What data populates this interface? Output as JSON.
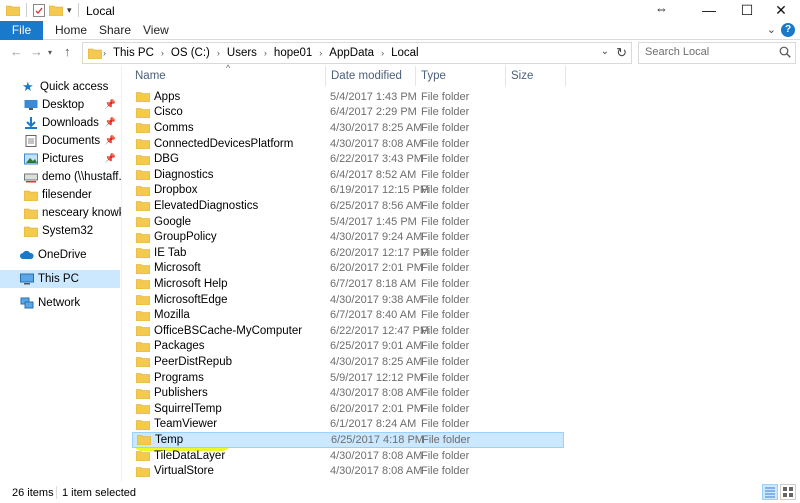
{
  "window": {
    "title": "Local",
    "minimize_glyph": "—",
    "maximize_glyph": "☐",
    "close_glyph": "✕"
  },
  "ribbon": {
    "tabs": [
      "File",
      "Home",
      "Share",
      "View"
    ]
  },
  "address": {
    "breadcrumbs": [
      "This PC",
      "OS (C:)",
      "Users",
      "hope01",
      "AppData",
      "Local"
    ]
  },
  "search": {
    "placeholder": "Search Local"
  },
  "nav_pane": {
    "items": [
      {
        "label": "Quick access",
        "icon": "star-icon",
        "pinned": false
      },
      {
        "label": "Desktop",
        "icon": "desktop-icon",
        "pinned": true
      },
      {
        "label": "Downloads",
        "icon": "download-icon",
        "pinned": true
      },
      {
        "label": "Documents",
        "icon": "documents-icon",
        "pinned": true
      },
      {
        "label": "Pictures",
        "icon": "pictures-icon",
        "pinned": true
      },
      {
        "label": "demo (\\\\hustaff.hu",
        "icon": "network-drive-icon",
        "pinned": false
      },
      {
        "label": "filesender",
        "icon": "folder-icon",
        "pinned": false
      },
      {
        "label": "nesceary knowkedg",
        "icon": "folder-icon",
        "pinned": false
      },
      {
        "label": "System32",
        "icon": "folder-icon",
        "pinned": false
      },
      {
        "label": "OneDrive",
        "icon": "onedrive-icon",
        "pinned": false
      },
      {
        "label": "This PC",
        "icon": "this-pc-icon",
        "pinned": false,
        "selected": true
      },
      {
        "label": "Network",
        "icon": "network-icon",
        "pinned": false
      }
    ]
  },
  "columns": {
    "name": "Name",
    "date": "Date modified",
    "type": "Type",
    "size": "Size"
  },
  "files": [
    {
      "name": "Apps",
      "date": "5/4/2017 1:43 PM",
      "type": "File folder"
    },
    {
      "name": "Cisco",
      "date": "6/4/2017 2:29 PM",
      "type": "File folder"
    },
    {
      "name": "Comms",
      "date": "4/30/2017 8:25 AM",
      "type": "File folder"
    },
    {
      "name": "ConnectedDevicesPlatform",
      "date": "4/30/2017 8:08 AM",
      "type": "File folder"
    },
    {
      "name": "DBG",
      "date": "6/22/2017 3:43 PM",
      "type": "File folder"
    },
    {
      "name": "Diagnostics",
      "date": "6/4/2017 8:52 AM",
      "type": "File folder"
    },
    {
      "name": "Dropbox",
      "date": "6/19/2017 12:15 PM",
      "type": "File folder"
    },
    {
      "name": "ElevatedDiagnostics",
      "date": "6/25/2017 8:56 AM",
      "type": "File folder"
    },
    {
      "name": "Google",
      "date": "5/4/2017 1:45 PM",
      "type": "File folder"
    },
    {
      "name": "GroupPolicy",
      "date": "4/30/2017 9:24 AM",
      "type": "File folder"
    },
    {
      "name": "IE Tab",
      "date": "6/20/2017 12:17 PM",
      "type": "File folder"
    },
    {
      "name": "Microsoft",
      "date": "6/20/2017 2:01 PM",
      "type": "File folder"
    },
    {
      "name": "Microsoft Help",
      "date": "6/7/2017 8:18 AM",
      "type": "File folder"
    },
    {
      "name": "MicrosoftEdge",
      "date": "4/30/2017 9:38 AM",
      "type": "File folder"
    },
    {
      "name": "Mozilla",
      "date": "6/7/2017 8:40 AM",
      "type": "File folder"
    },
    {
      "name": "OfficeBSCache-MyComputer",
      "date": "6/22/2017 12:47 PM",
      "type": "File folder"
    },
    {
      "name": "Packages",
      "date": "6/25/2017 9:01 AM",
      "type": "File folder"
    },
    {
      "name": "PeerDistRepub",
      "date": "4/30/2017 8:25 AM",
      "type": "File folder"
    },
    {
      "name": "Programs",
      "date": "5/9/2017 12:12 PM",
      "type": "File folder"
    },
    {
      "name": "Publishers",
      "date": "4/30/2017 8:08 AM",
      "type": "File folder"
    },
    {
      "name": "SquirrelTemp",
      "date": "6/20/2017 2:01 PM",
      "type": "File folder"
    },
    {
      "name": "TeamViewer",
      "date": "6/1/2017 8:24 AM",
      "type": "File folder"
    },
    {
      "name": "Temp",
      "date": "6/25/2017 4:18 PM",
      "type": "File folder",
      "selected": true
    },
    {
      "name": "TileDataLayer",
      "date": "4/30/2017 8:08 AM",
      "type": "File folder"
    },
    {
      "name": "VirtualStore",
      "date": "4/30/2017 8:08 AM",
      "type": "File folder"
    }
  ],
  "status": {
    "item_count": "26 items",
    "selection": "1 item selected"
  },
  "colors": {
    "accent": "#1979ca",
    "selection": "#cce8ff",
    "selection_border": "#99d1ff",
    "folder": "#f4c94f",
    "highlighter": "#e8f700"
  }
}
